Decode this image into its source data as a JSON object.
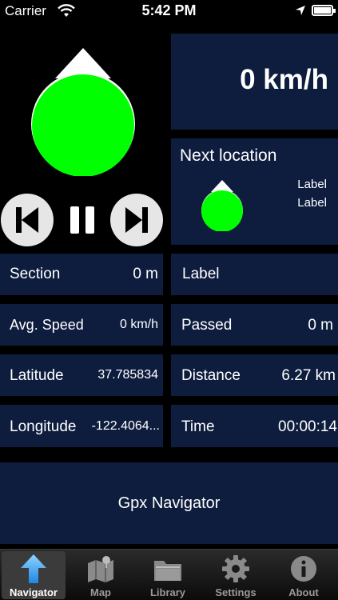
{
  "status_bar": {
    "carrier": "Carrier",
    "time": "5:42 PM"
  },
  "speed": {
    "value": "0 km/h"
  },
  "next_location": {
    "title": "Next location",
    "label1": "Label",
    "label2": "Label"
  },
  "stats_left": [
    {
      "label": "Section",
      "value": "0 m"
    },
    {
      "label": "Avg. Speed",
      "value": "0 km/h"
    },
    {
      "label": "Latitude",
      "value": "37.785834"
    },
    {
      "label": "Longitude",
      "value": "-122.4064..."
    }
  ],
  "stats_right": [
    {
      "label": "Label",
      "value": ""
    },
    {
      "label": "Passed",
      "value": "0 m"
    },
    {
      "label": "Distance",
      "value": "6.27 km"
    },
    {
      "label": "Time",
      "value": "00:00:14"
    }
  ],
  "app_name": "Gpx Navigator",
  "tabs": [
    {
      "label": "Navigator",
      "icon": "arrow-up-icon",
      "active": true
    },
    {
      "label": "Map",
      "icon": "map-icon",
      "active": false
    },
    {
      "label": "Library",
      "icon": "folder-icon",
      "active": false
    },
    {
      "label": "Settings",
      "icon": "gear-icon",
      "active": false
    },
    {
      "label": "About",
      "icon": "info-icon",
      "active": false
    }
  ],
  "colors": {
    "panel": "#0e1d3e",
    "indicator": "#00ff00",
    "background": "#000000"
  }
}
